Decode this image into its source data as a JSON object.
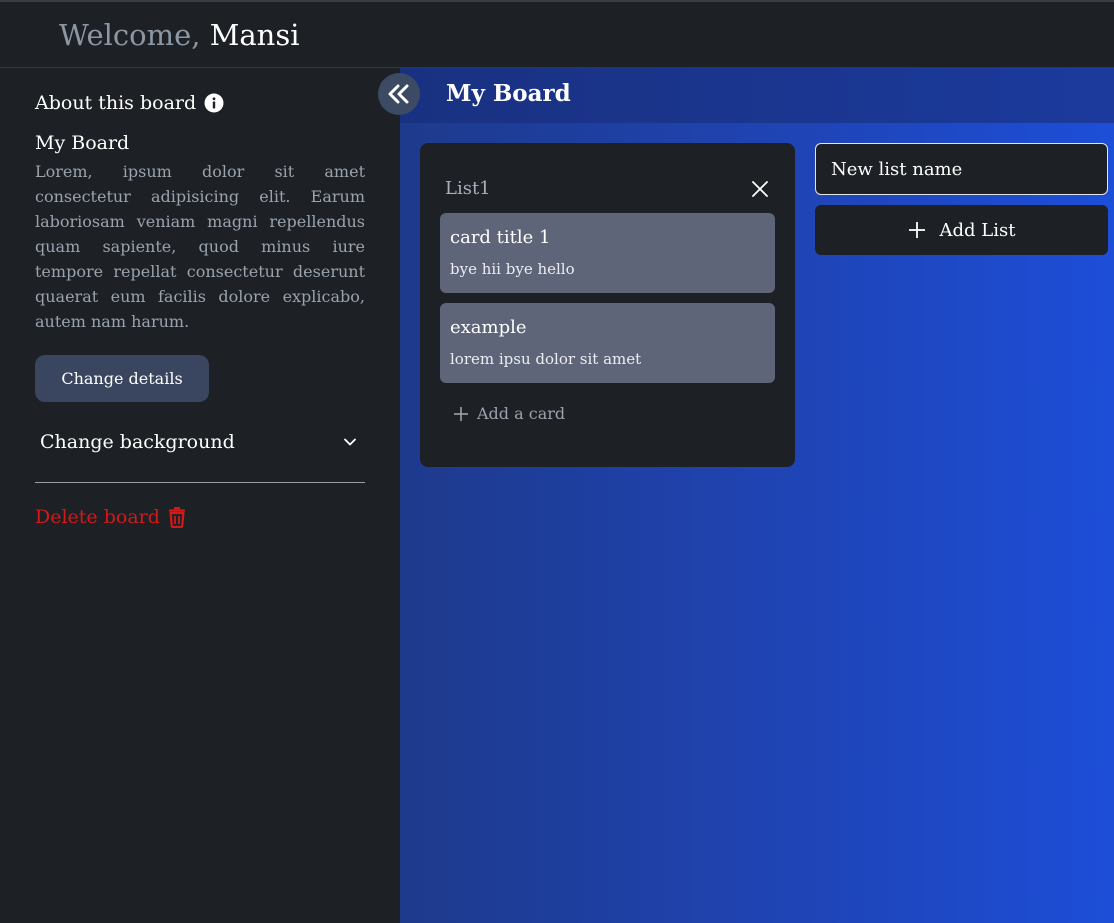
{
  "header": {
    "greeting": "Welcome,",
    "user_name": "Mansi"
  },
  "sidebar": {
    "about_title": "About this board",
    "about_icon": "info-icon",
    "board_name": "My Board",
    "board_description": "Lorem, ipsum dolor sit amet consectetur adipisicing elit. Earum laboriosam veniam magni repellendus quam sapiente, quod minus iure tempore repellat consectetur deserunt quaerat eum facilis dolore explicabo, autem nam harum.",
    "change_details_label": "Change details",
    "change_background_label": "Change background",
    "delete_board_label": "Delete board",
    "delete_icon": "trash-icon",
    "collapse_icon": "double-chevron-left-icon"
  },
  "board": {
    "title": "My Board",
    "lists": [
      {
        "title": "List1",
        "cards": [
          {
            "title": "card title 1",
            "description": "bye hii bye hello"
          },
          {
            "title": "example",
            "description": "lorem ipsu dolor sit amet"
          }
        ],
        "add_card_label": "Add a card"
      }
    ],
    "new_list": {
      "placeholder": "New list name",
      "value": "",
      "add_button_label": "Add List"
    }
  },
  "colors": {
    "background": "#1d2025",
    "accent_button": "#3a4660",
    "card": "#5e6579",
    "danger": "#d11a1a",
    "board_blue": "#1d4ed8"
  }
}
